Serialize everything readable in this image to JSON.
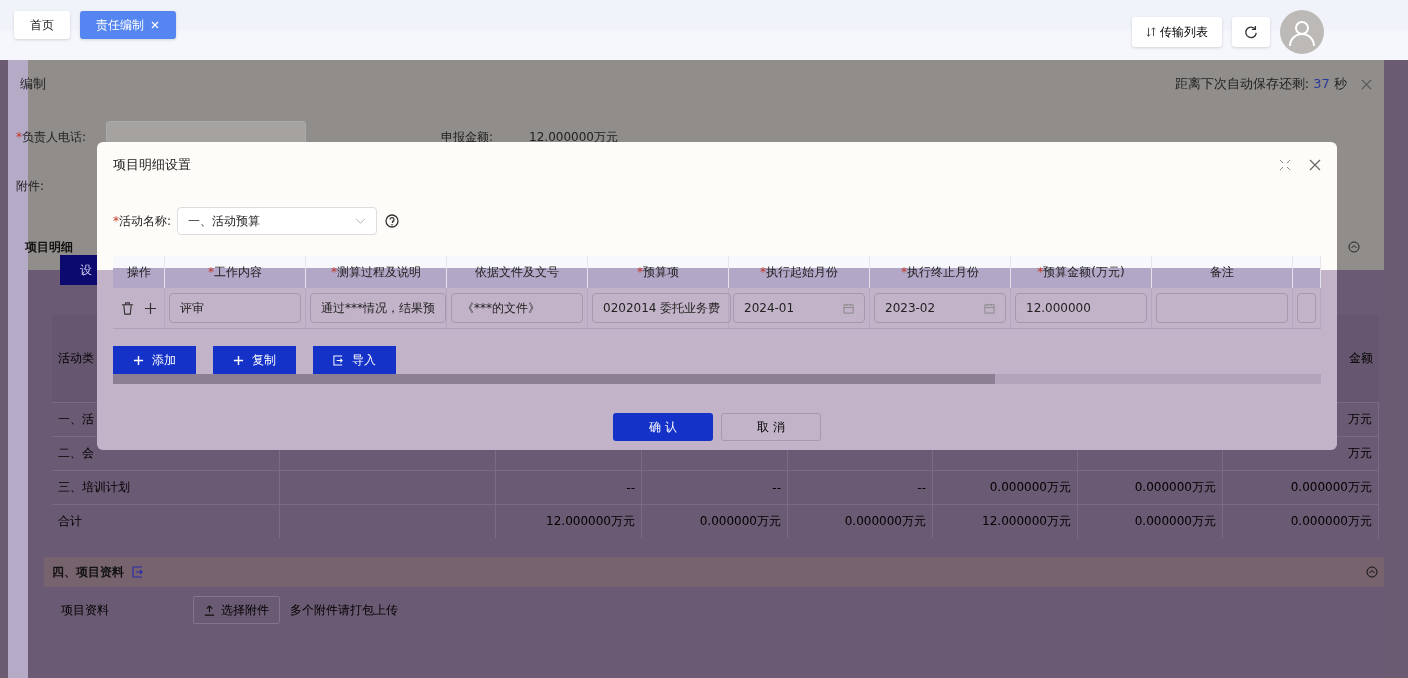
{
  "tabs": [
    {
      "label": "首页",
      "selected": false,
      "closable": false
    },
    {
      "label": "责任编制",
      "selected": true,
      "closable": true
    }
  ],
  "header_actions": {
    "transfer_list": "传输列表"
  },
  "editor": {
    "title": "编制",
    "autosave": {
      "label": "距离下次自动保存还剩:",
      "seconds": "37",
      "unit": "秒"
    },
    "fields": [
      {
        "label": "负责人电话:",
        "mark": "*"
      },
      {
        "label": "申报金额:",
        "value": "12.000000万元"
      }
    ],
    "attachment_label": "附件:",
    "detail_section": {
      "title": "项目明细",
      "button": "设"
    },
    "summary_table": {
      "header": {
        "first": "活动类",
        "last": "金额"
      },
      "rows": [
        {
          "cells": [
            "一、活",
            "",
            "",
            "",
            "",
            "",
            "",
            "万元"
          ]
        },
        {
          "cells": [
            "二、会",
            "",
            "",
            "",
            "",
            "",
            "",
            "万元"
          ]
        },
        {
          "cells": [
            "三、培训计划",
            "",
            "--",
            "--",
            "--",
            "0.000000万元",
            "0.000000万元",
            "0.000000万元"
          ]
        },
        {
          "cells": [
            "合计",
            "",
            "12.000000万元",
            "0.000000万元",
            "0.000000万元",
            "12.000000万元",
            "0.000000万元",
            "0.000000万元"
          ]
        }
      ]
    },
    "materials_section": {
      "title": "四、项目资料",
      "row_label": "项目资料",
      "upload_button": "选择附件",
      "hint": "多个附件请打包上传"
    }
  },
  "dialog": {
    "title": "项目明细设置",
    "activity_field": {
      "label": "活动名称:",
      "mark": "*",
      "value": "一、活动预算"
    },
    "columns": [
      {
        "label": "操作"
      },
      {
        "label": "工作内容",
        "mark": "*"
      },
      {
        "label": "测算过程及说明",
        "mark": "*"
      },
      {
        "label": "依据文件及文号"
      },
      {
        "label": "预算项",
        "mark": "*"
      },
      {
        "label": "执行起始月份",
        "mark": "*"
      },
      {
        "label": "执行终止月份",
        "mark": "*"
      },
      {
        "label": "预算金额(万元)",
        "mark": "*"
      },
      {
        "label": "备注"
      }
    ],
    "rows": [
      {
        "cells": [
          {
            "kind": "actions"
          },
          {
            "kind": "text",
            "value": "评审"
          },
          {
            "kind": "text",
            "value": "通过***情况，结果预"
          },
          {
            "kind": "text",
            "value": "《***的文件》"
          },
          {
            "kind": "text",
            "value": "0202014 委托业务费"
          },
          {
            "kind": "month",
            "value": "2024-01"
          },
          {
            "kind": "month",
            "value": "2023-02"
          },
          {
            "kind": "text",
            "value": "12.000000"
          },
          {
            "kind": "text"
          }
        ]
      }
    ],
    "actions": [
      {
        "label": "添加",
        "kind": "add"
      },
      {
        "label": "复制",
        "kind": "copy"
      },
      {
        "label": "导入",
        "kind": "import"
      }
    ],
    "footer": {
      "confirm": "确 认",
      "cancel": "取 消"
    }
  }
}
